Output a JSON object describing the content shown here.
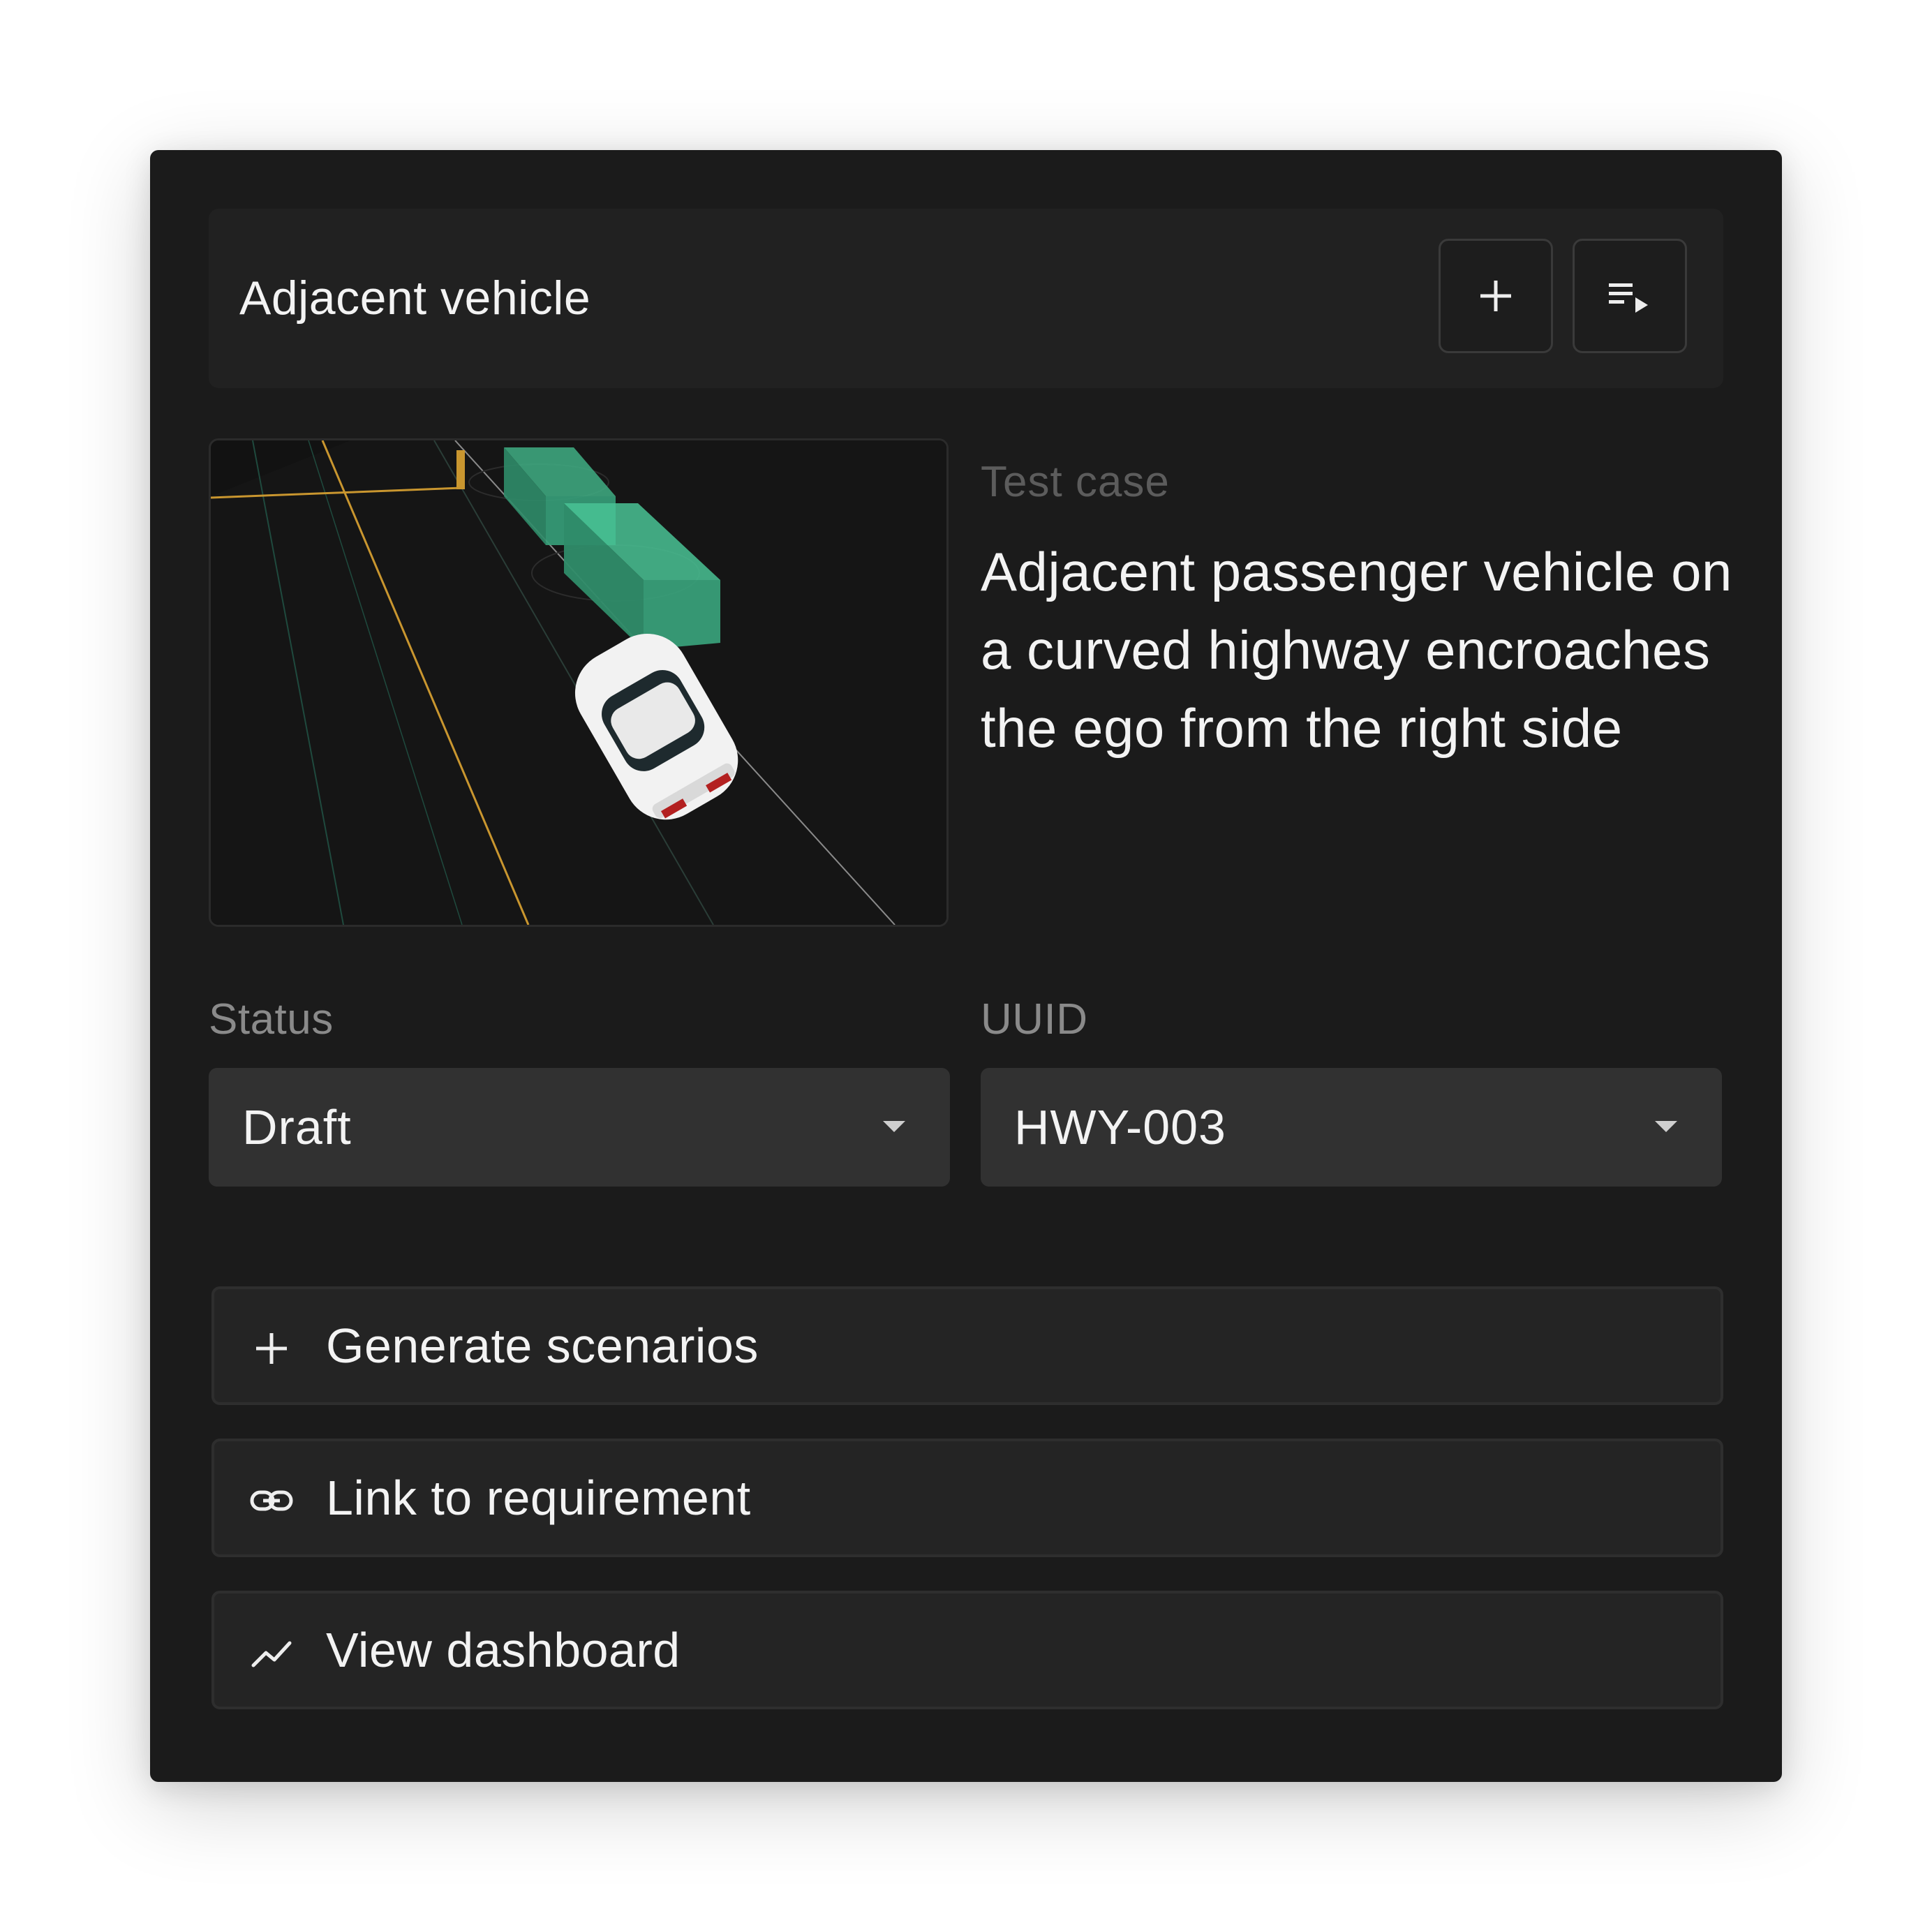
{
  "header": {
    "title": "Adjacent vehicle",
    "add_icon": "plus-icon",
    "queue_icon": "playlist-play-icon"
  },
  "test_case": {
    "label": "Test case",
    "description": "Adjacent passenger vehicle on a curved highway encroaches the ego from the right side"
  },
  "status": {
    "label": "Status",
    "value": "Draft"
  },
  "uuid": {
    "label": "UUID",
    "value": "HWY-003"
  },
  "actions": [
    {
      "label": "Generate scenarios",
      "icon": "plus-icon"
    },
    {
      "label": "Link to requirement",
      "icon": "link-icon"
    },
    {
      "label": "View dashboard",
      "icon": "trending-up-icon"
    }
  ],
  "colors": {
    "background": "#1b1b1b",
    "panel": "#212121",
    "select": "#313131",
    "accent_box": "#3fae84",
    "lane_line": "#c9962f"
  }
}
